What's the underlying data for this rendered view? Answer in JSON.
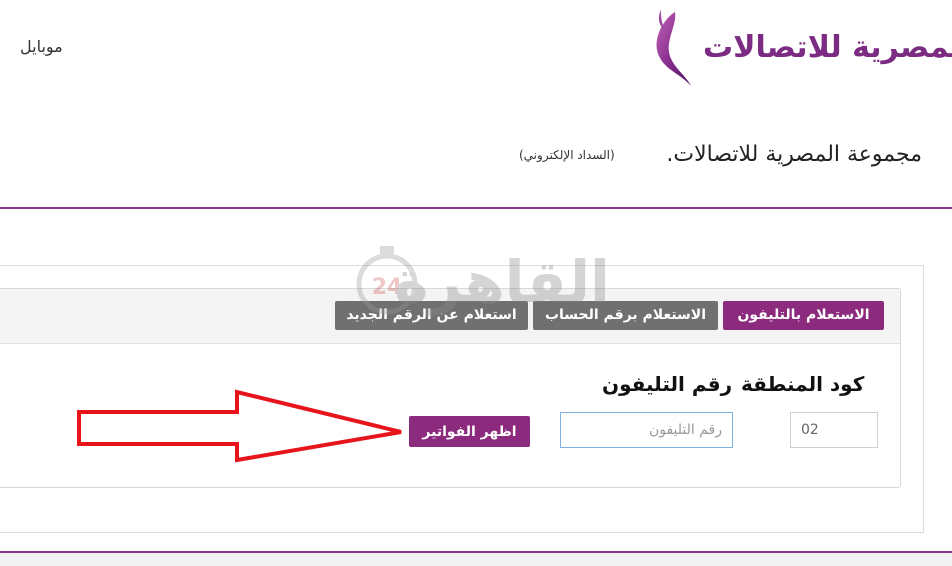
{
  "header": {
    "mobile_link": "موبايل",
    "logo_text": "المصرية للاتصالات"
  },
  "page": {
    "title": "مجموعة المصرية للاتصالات.",
    "subtitle": "(السداد الإلكتروني)"
  },
  "tabs": [
    {
      "label": "الاستعلام بالتليفون",
      "active": true
    },
    {
      "label": "الاستعلام برقم الحساب",
      "active": false
    },
    {
      "label": "استعلام عن الرقم الجديد",
      "active": false
    }
  ],
  "form": {
    "area_code_label": "كود المنطقة",
    "phone_label": "رقم التليفون",
    "area_code_value": "02",
    "phone_placeholder": "رقم التليفون",
    "submit_label": "اظهر الفواتير"
  },
  "watermark": {
    "text": "القاهرة",
    "badge": "24"
  },
  "colors": {
    "brand": "#8c2a7e",
    "inactive_tab": "#707070",
    "rule": "#8a3a8c",
    "arrow": "#e8141b"
  }
}
